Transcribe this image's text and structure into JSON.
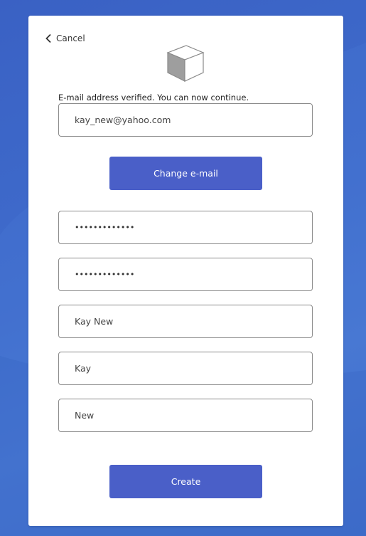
{
  "cancel": {
    "label": "Cancel",
    "icon": "chevron-left-icon"
  },
  "logo": {
    "icon": "cube-icon"
  },
  "status": {
    "message": "E-mail address verified. You can now continue."
  },
  "email": {
    "value": "kay_new@yahoo.com"
  },
  "change_email": {
    "label": "Change e-mail"
  },
  "password": {
    "value": "•••••••••••••"
  },
  "confirm_password": {
    "value": "•••••••••••••"
  },
  "display_name": {
    "value": "Kay New"
  },
  "given_name": {
    "value": "Kay"
  },
  "surname": {
    "value": "New"
  },
  "create": {
    "label": "Create"
  },
  "colors": {
    "accent": "#4a5fc8",
    "background": "#3f6ccc",
    "card": "#ffffff"
  }
}
